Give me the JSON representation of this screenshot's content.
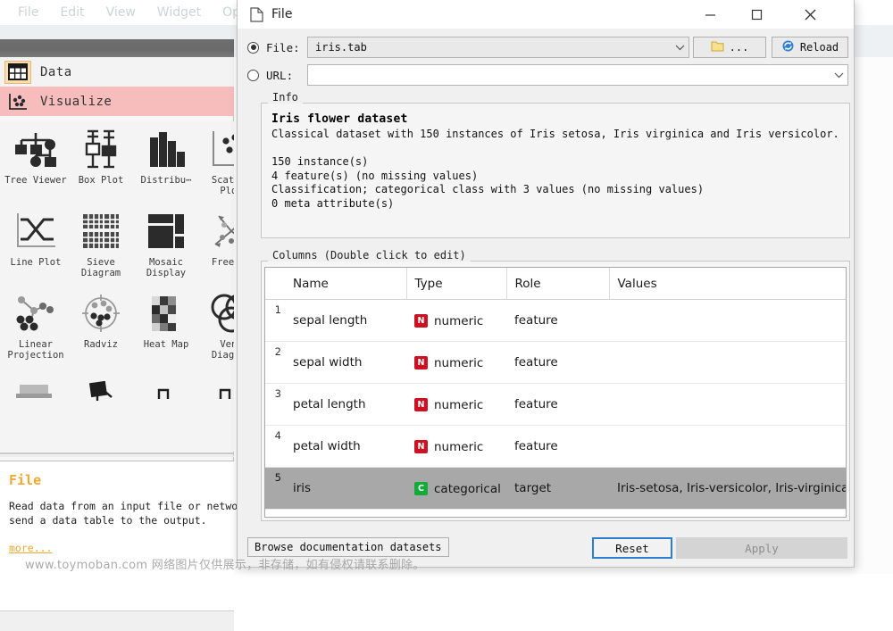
{
  "app": {
    "menu": [
      "File",
      "Edit",
      "View",
      "Widget",
      "Options"
    ],
    "categories": [
      {
        "label": "Data",
        "icon": "table-icon"
      },
      {
        "label": "Visualize",
        "icon": "scatter-icon"
      }
    ],
    "widgets": [
      {
        "label": "Tree\nViewer",
        "icon": "tree-viewer-icon"
      },
      {
        "label": "Box Plot",
        "icon": "box-plot-icon"
      },
      {
        "label": "Distribu⋯",
        "icon": "distributions-icon"
      },
      {
        "label": "Scatter\nPlot",
        "icon": "scatter-plot-icon"
      },
      {
        "label": "Line Plot",
        "icon": "line-plot-icon"
      },
      {
        "label": "Sieve\nDiagram",
        "icon": "sieve-diagram-icon"
      },
      {
        "label": "Mosaic\nDisplay",
        "icon": "mosaic-display-icon"
      },
      {
        "label": "FreeVi⋯",
        "icon": "freeviz-icon"
      },
      {
        "label": "Linear\nProjection",
        "icon": "linear-projection-icon"
      },
      {
        "label": "Radviz",
        "icon": "radviz-icon"
      },
      {
        "label": "Heat Map",
        "icon": "heat-map-icon"
      },
      {
        "label": "Venn\nDiagram",
        "icon": "venn-diagram-icon"
      }
    ],
    "description": {
      "title": "File",
      "body": "Read data from an input file or network\nsend a data table to the output.",
      "more": "more..."
    }
  },
  "watermark": "www.toymoban.com 网络图片仅供展示，非存储，如有侵权请联系删除。",
  "dialog": {
    "title": "File",
    "title_icon": "document-icon",
    "window_buttons": {
      "minimize": "minimize-icon",
      "maximize": "maximize-icon",
      "close": "close-icon"
    },
    "source": {
      "file_label": "File:",
      "file_selected": true,
      "file_value": "iris.tab",
      "url_label": "URL:",
      "url_selected": false,
      "url_value": "",
      "browse_label": "...",
      "browse_icon": "folder-icon",
      "reload_label": "Reload",
      "reload_icon": "reload-icon"
    },
    "info": {
      "title": "Info",
      "heading": "Iris flower dataset",
      "text": "Classical dataset with 150 instances of Iris setosa, Iris virginica and Iris versicolor.\n\n150 instance(s)\n4 feature(s) (no missing values)\nClassification; categorical class with 3 values (no missing values)\n0 meta attribute(s)"
    },
    "columns": {
      "title": "Columns (Double click to edit)",
      "headers": [
        "",
        "Name",
        "Type",
        "Role",
        "Values"
      ],
      "rows": [
        {
          "index": "1",
          "name": "sepal length",
          "type": "numeric",
          "type_icon": "N",
          "type_kind": "num",
          "role": "feature",
          "values": "",
          "selected": false
        },
        {
          "index": "2",
          "name": "sepal width",
          "type": "numeric",
          "type_icon": "N",
          "type_kind": "num",
          "role": "feature",
          "values": "",
          "selected": false
        },
        {
          "index": "3",
          "name": "petal length",
          "type": "numeric",
          "type_icon": "N",
          "type_kind": "num",
          "role": "feature",
          "values": "",
          "selected": false
        },
        {
          "index": "4",
          "name": "petal width",
          "type": "numeric",
          "type_icon": "N",
          "type_kind": "num",
          "role": "feature",
          "values": "",
          "selected": false
        },
        {
          "index": "5",
          "name": "iris",
          "type": "categorical",
          "type_icon": "C",
          "type_kind": "cat",
          "role": "target",
          "values": "Iris-setosa, Iris-versicolor, Iris-virginica",
          "selected": true
        }
      ]
    },
    "footer": {
      "browse_docs_label": "Browse documentation datasets",
      "reset_label": "Reset",
      "apply_label": "Apply",
      "apply_disabled": true
    },
    "colors": {
      "accent_focus": "#2a7fd4",
      "numeric_badge": "#cc1122",
      "categorical_badge": "#12ab38",
      "selection": "#a8a8a8"
    }
  }
}
